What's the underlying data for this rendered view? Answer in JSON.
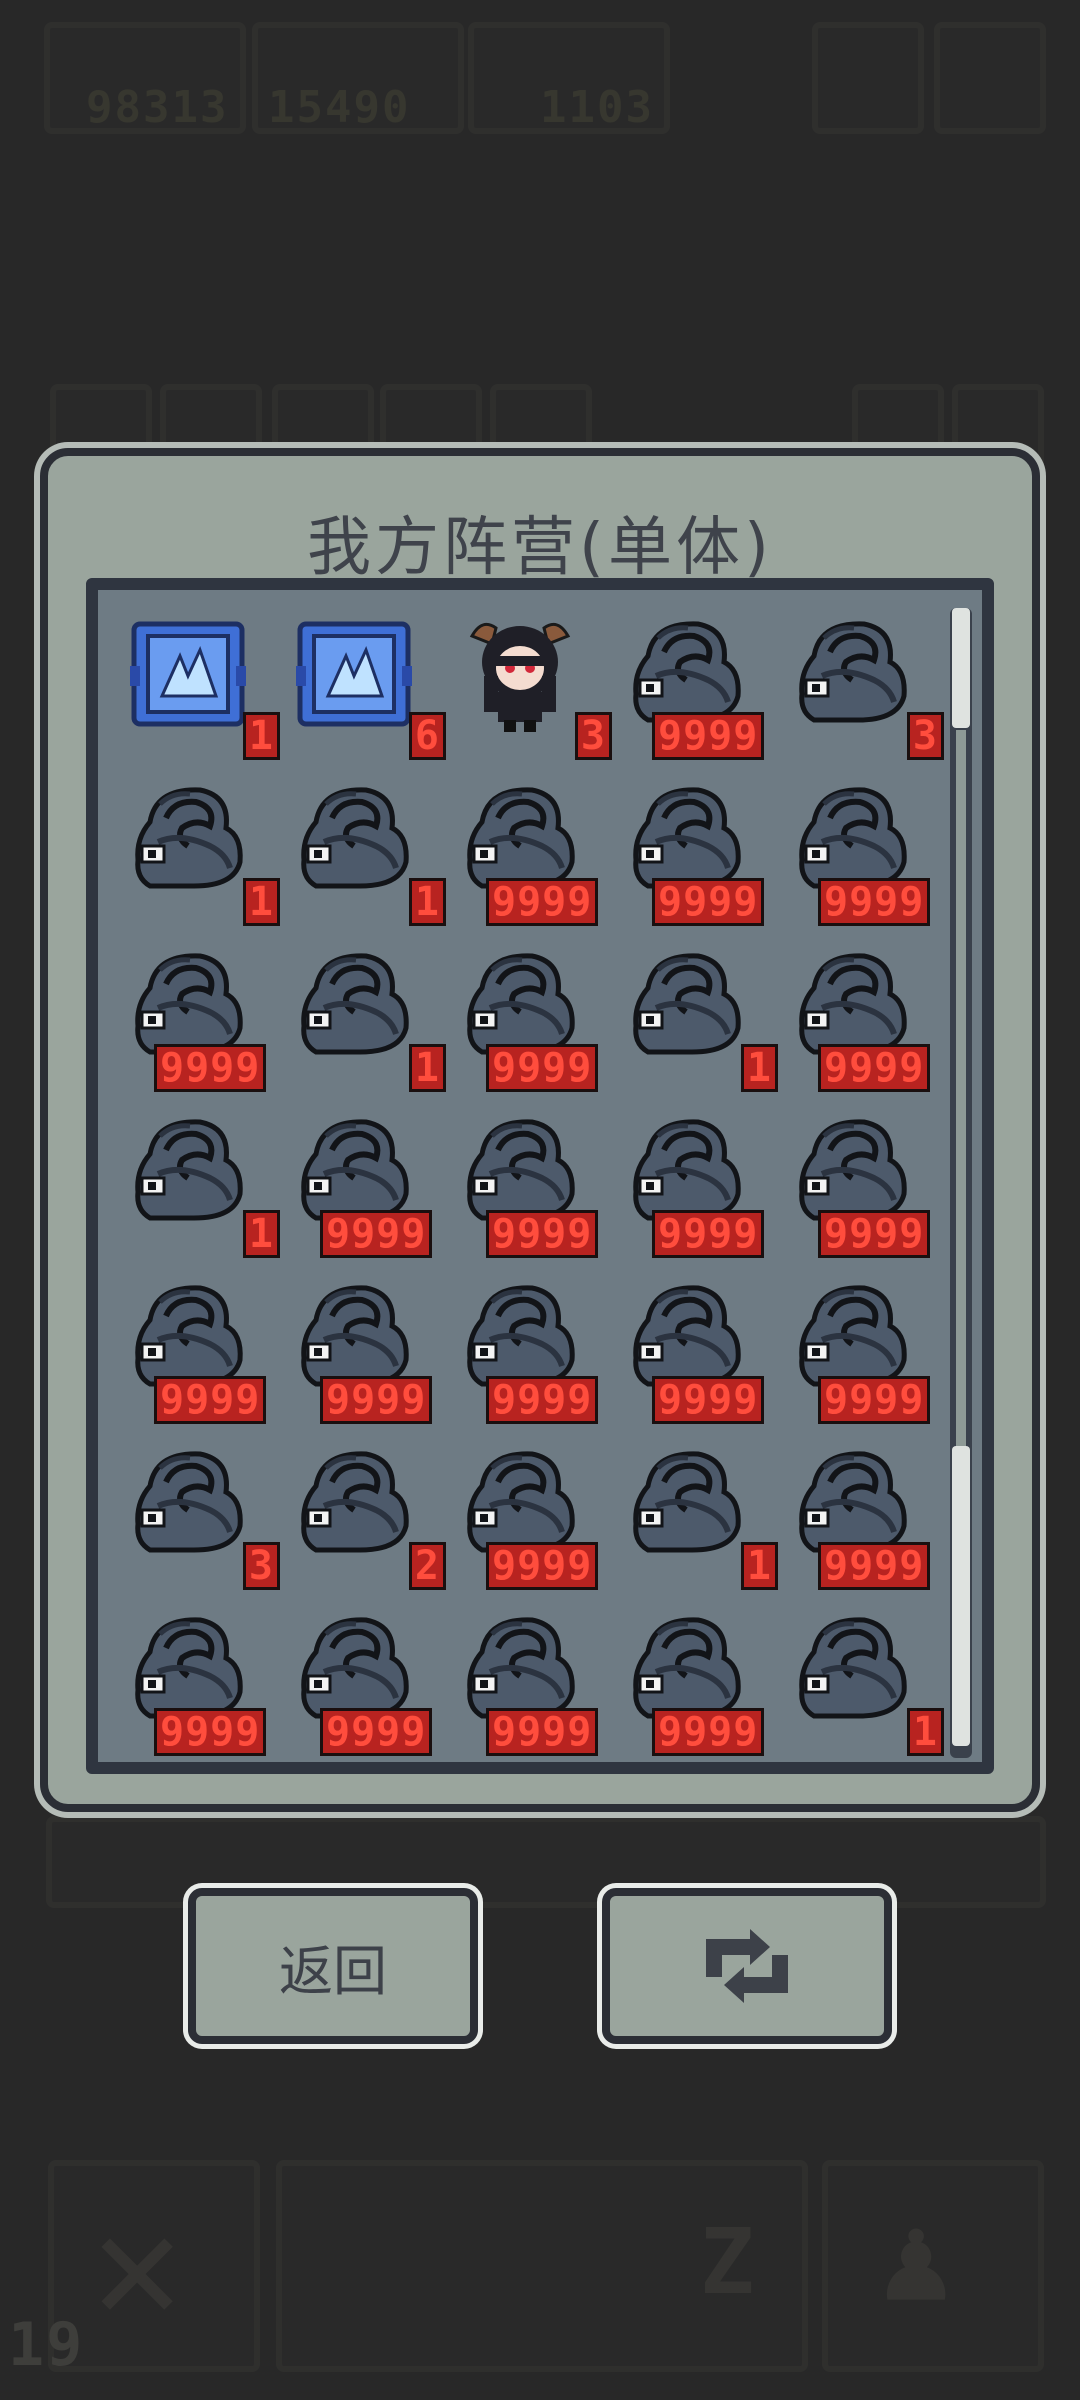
{
  "hud": {
    "resources": [
      "98313",
      "15490",
      "1103"
    ],
    "level": "19"
  },
  "dialog": {
    "title": "我方阵营(单体)",
    "units": [
      {
        "type": "crystal",
        "count": "1"
      },
      {
        "type": "crystal",
        "count": "6"
      },
      {
        "type": "girl",
        "count": "3"
      },
      {
        "type": "beast",
        "count": "9999"
      },
      {
        "type": "beast",
        "count": "3"
      },
      {
        "type": "beast",
        "count": "1"
      },
      {
        "type": "beast",
        "count": "1"
      },
      {
        "type": "beast",
        "count": "9999"
      },
      {
        "type": "beast",
        "count": "9999"
      },
      {
        "type": "beast",
        "count": "9999"
      },
      {
        "type": "beast",
        "count": "9999"
      },
      {
        "type": "beast",
        "count": "1"
      },
      {
        "type": "beast",
        "count": "9999"
      },
      {
        "type": "beast",
        "count": "1"
      },
      {
        "type": "beast",
        "count": "9999"
      },
      {
        "type": "beast",
        "count": "1"
      },
      {
        "type": "beast",
        "count": "9999"
      },
      {
        "type": "beast",
        "count": "9999"
      },
      {
        "type": "beast",
        "count": "9999"
      },
      {
        "type": "beast",
        "count": "9999"
      },
      {
        "type": "beast",
        "count": "9999"
      },
      {
        "type": "beast",
        "count": "9999"
      },
      {
        "type": "beast",
        "count": "9999"
      },
      {
        "type": "beast",
        "count": "9999"
      },
      {
        "type": "beast",
        "count": "9999"
      },
      {
        "type": "beast",
        "count": "3"
      },
      {
        "type": "beast",
        "count": "2"
      },
      {
        "type": "beast",
        "count": "9999"
      },
      {
        "type": "beast",
        "count": "1"
      },
      {
        "type": "beast",
        "count": "9999"
      },
      {
        "type": "beast",
        "count": "9999"
      },
      {
        "type": "beast",
        "count": "9999"
      },
      {
        "type": "beast",
        "count": "9999"
      },
      {
        "type": "beast",
        "count": "9999"
      },
      {
        "type": "beast",
        "count": "1"
      }
    ]
  },
  "buttons": {
    "back_label": "返回",
    "refresh_icon": "refresh-icon"
  },
  "colors": {
    "count_bg": "#b82320",
    "count_text": "#ff4d3d",
    "panel": "#6e7b84",
    "dialog": "#9aa59d"
  }
}
